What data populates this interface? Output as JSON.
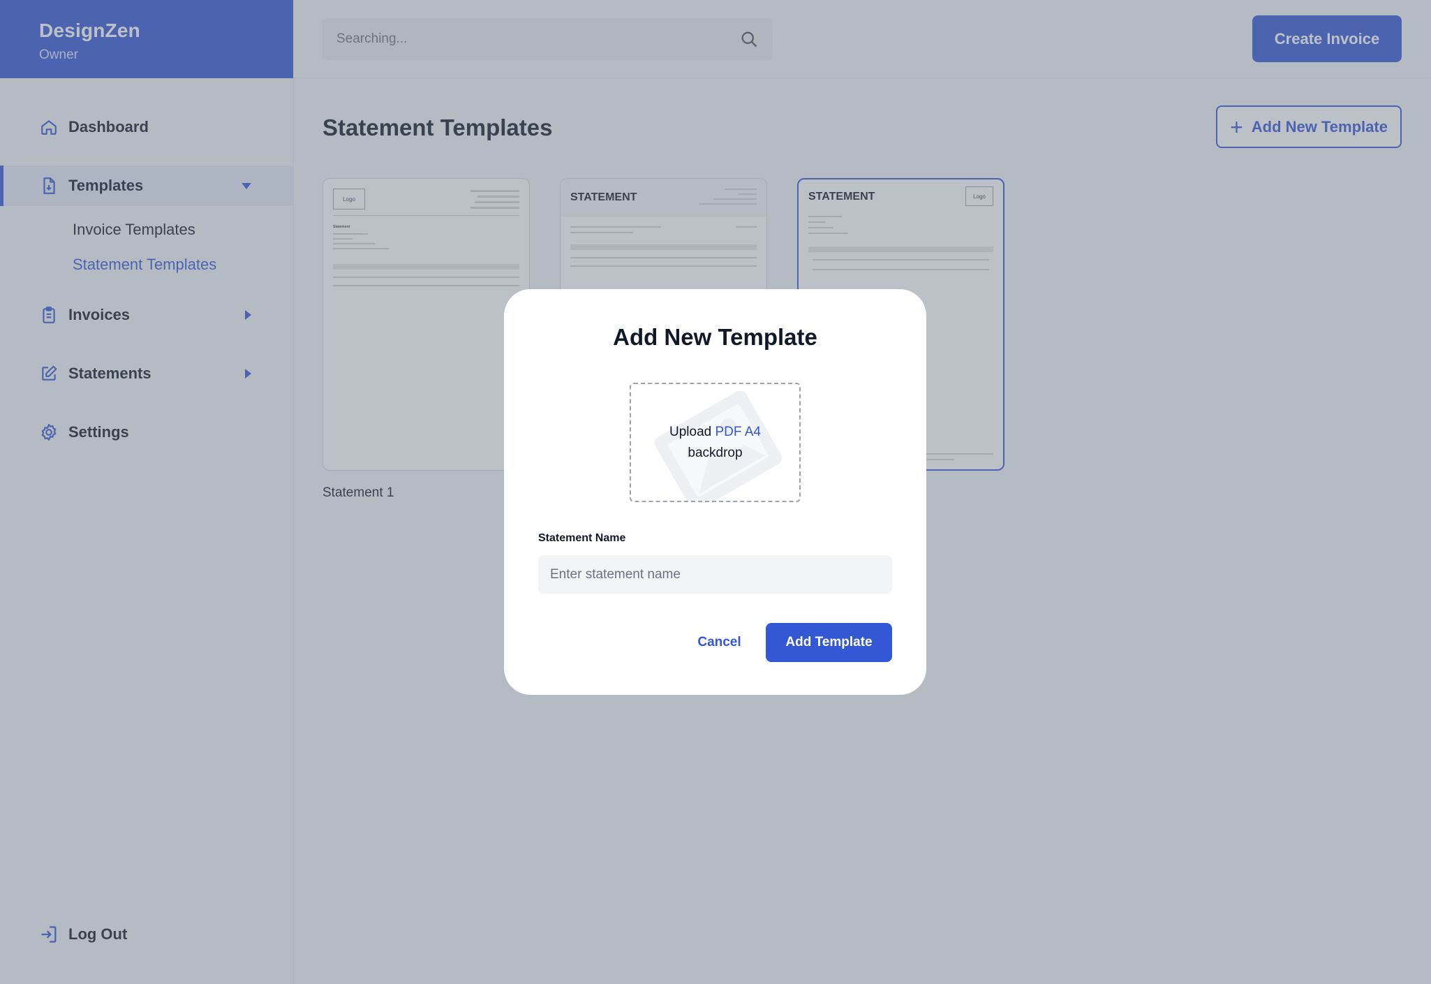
{
  "app": {
    "brand_name": "DesignZen",
    "brand_role": "Owner"
  },
  "sidebar": {
    "items": [
      {
        "label": "Dashboard",
        "icon": "home-icon"
      },
      {
        "label": "Templates",
        "icon": "file-download-icon",
        "expanded": true
      },
      {
        "label": "Invoices",
        "icon": "clipboard-icon"
      },
      {
        "label": "Statements",
        "icon": "edit-icon"
      },
      {
        "label": "Settings",
        "icon": "gear-icon"
      }
    ],
    "sub_items": [
      {
        "label": "Invoice Templates"
      },
      {
        "label": "Statement Templates",
        "current": true
      }
    ],
    "logout_label": "Log Out"
  },
  "topbar": {
    "search_placeholder": "Searching...",
    "create_label": "Create Invoice"
  },
  "main": {
    "title": "Statement Templates",
    "add_new_label": "Add New Template",
    "cards": [
      {
        "label": "Statement 1",
        "logo_text": "Logo",
        "doc_heading": "Statement"
      },
      {
        "label": "",
        "doc_heading": "STATEMENT"
      },
      {
        "label": "",
        "doc_heading": "STATEMENT",
        "logo_text": "Logo"
      }
    ]
  },
  "modal": {
    "title": "Add New Template",
    "upload_prefix": "Upload",
    "upload_link": "PDF A4",
    "upload_suffix": "backdrop",
    "field_label": "Statement Name",
    "field_placeholder": "Enter statement name",
    "cancel_label": "Cancel",
    "submit_label": "Add Template"
  },
  "colors": {
    "accent": "#3457d5",
    "overlay": "#6b7582"
  }
}
